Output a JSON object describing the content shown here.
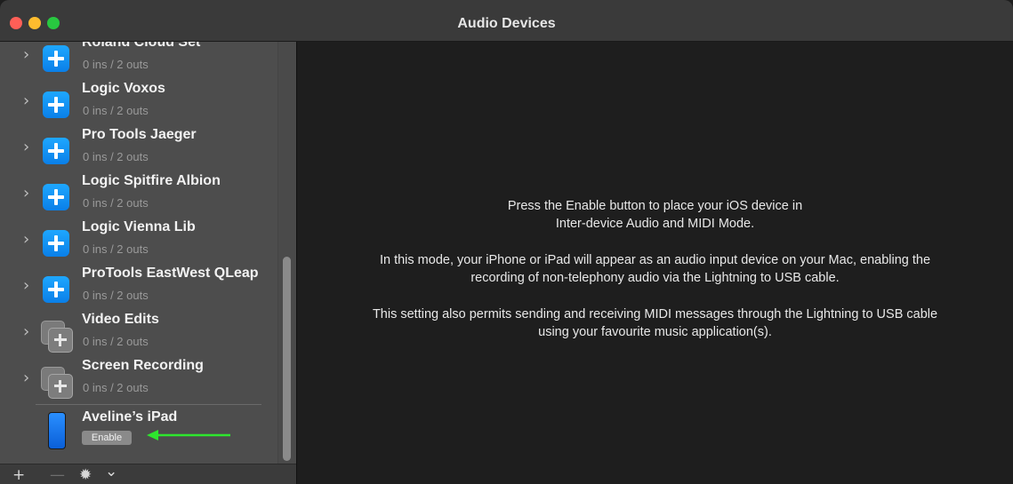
{
  "window": {
    "title": "Audio Devices"
  },
  "devices": [
    {
      "name": "Roland Cloud Set",
      "io": "0 ins / 2 outs",
      "icon": "plus-icon"
    },
    {
      "name": "Logic Voxos",
      "io": "0 ins / 2 outs",
      "icon": "plus-icon"
    },
    {
      "name": "Pro Tools Jaeger",
      "io": "0 ins / 2 outs",
      "icon": "plus-icon"
    },
    {
      "name": "Logic Spitfire Albion",
      "io": "0 ins / 2 outs",
      "icon": "plus-icon"
    },
    {
      "name": "Logic Vienna Lib",
      "io": "0 ins / 2 outs",
      "icon": "plus-icon"
    },
    {
      "name": "ProTools EastWest QLeap",
      "io": "0 ins / 2 outs",
      "icon": "plus-icon"
    },
    {
      "name": "Video Edits",
      "io": "0 ins / 2 outs",
      "icon": "aggregate-device-icon"
    },
    {
      "name": "Screen Recording",
      "io": "0 ins / 2 outs",
      "icon": "aggregate-device-icon"
    }
  ],
  "ipad": {
    "name": "Aveline’s iPad",
    "enable_label": "Enable",
    "icon": "ipad-icon"
  },
  "toolbar": {
    "add": "+",
    "remove": "—",
    "settings": "✹",
    "chevron": "⌄"
  },
  "main": {
    "line1": "Press the Enable button to place your iOS device in",
    "line2": "Inter-device Audio and MIDI Mode.",
    "line3": "In this mode, your iPhone or iPad will appear as an audio input device on your Mac, enabling the",
    "line4": "recording of non-telephony audio via the Lightning to USB cable.",
    "line5": "This setting also permits sending and receiving MIDI messages through the Lightning to USB cable",
    "line6": "using your favourite music application(s)."
  },
  "colors": {
    "accent_blue": "#0a84ff",
    "arrow_green": "#2ee62e",
    "sidebar_bg": "#4d4d4d",
    "main_bg": "#1e1e1e"
  }
}
